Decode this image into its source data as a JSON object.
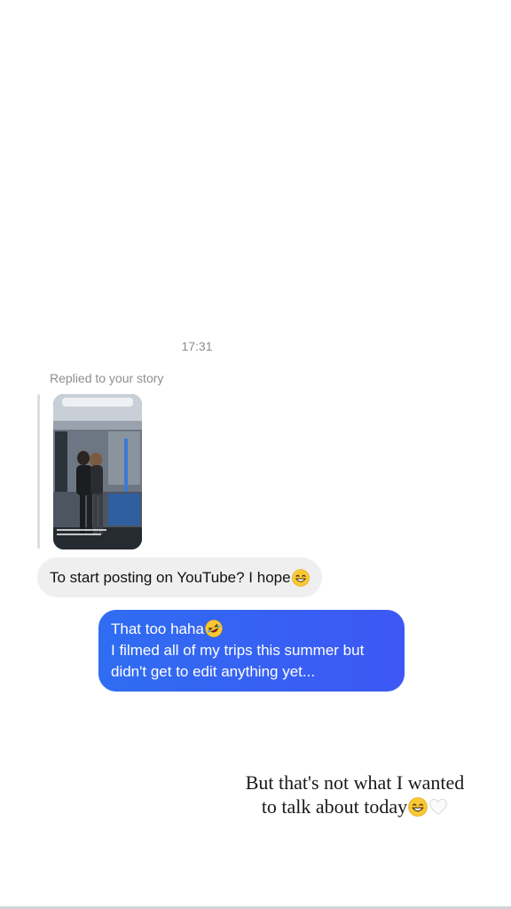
{
  "thread": {
    "timestamp": "17:31",
    "replied_label": "Replied to your story",
    "incoming_message": "To start posting on YouTube? I hope",
    "outgoing_message": {
      "line1": "That too haha",
      "line2": "I filmed all of my trips this summer but",
      "line3": "didn't get to edit anything yet..."
    }
  },
  "story_caption": {
    "line1": "But that's not what I wanted",
    "line2": "to talk about today"
  },
  "icons": {
    "incoming_emoji": "grinning-face-emoji",
    "outgoing_emoji": "rolling-laughing-emoji",
    "caption_emoji_1": "grinning-face-emoji",
    "caption_emoji_2": "white-heart-emoji"
  },
  "colors": {
    "background": "#ffffff",
    "incoming_bubble": "#efefef",
    "outgoing_bubble_start": "#2f6df1",
    "outgoing_bubble_end": "#3d57f5",
    "meta_text": "#8e8e8e"
  }
}
